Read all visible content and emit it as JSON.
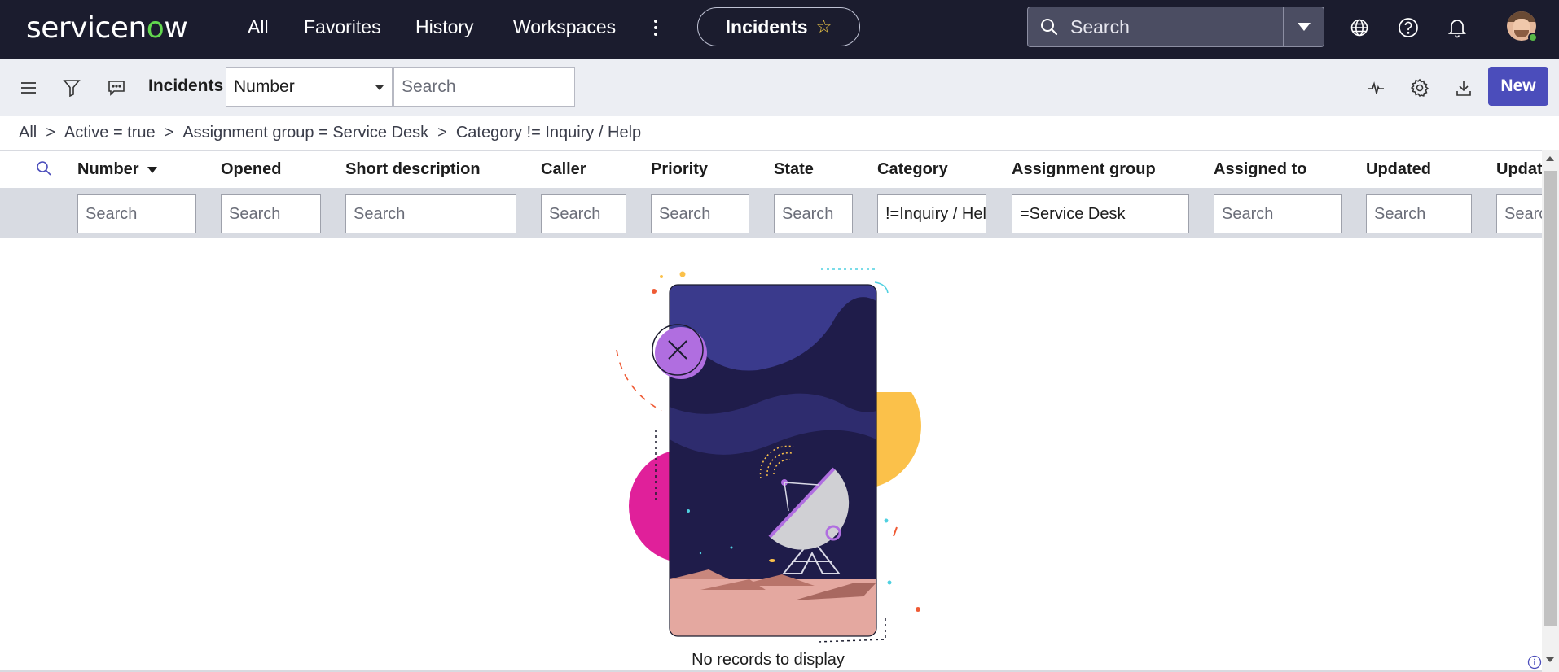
{
  "header": {
    "logo_text_1": "servicen",
    "logo_text_2": "o",
    "logo_text_3": "w",
    "nav": [
      "All",
      "Favorites",
      "History",
      "Workspaces"
    ],
    "context_title": "Incidents",
    "search_placeholder": "Search",
    "icons": [
      "globe-icon",
      "help-icon",
      "bell-icon"
    ]
  },
  "listbar": {
    "title": "Incidents",
    "field_select_value": "Number",
    "search_placeholder": "Search",
    "new_label": "New",
    "icons": [
      "hamburger-icon",
      "filter-icon",
      "comments-icon",
      "activity-icon",
      "gear-icon",
      "download-icon"
    ]
  },
  "breadcrumb": [
    "All",
    "Active = true",
    "Assignment group = Service Desk",
    "Category != Inquiry / Help"
  ],
  "table": {
    "columns": [
      "Number",
      "Opened",
      "Short description",
      "Caller",
      "Priority",
      "State",
      "Category",
      "Assignment group",
      "Assigned to",
      "Updated",
      "Updated by"
    ],
    "filters": [
      "Search",
      "Search",
      "Search",
      "Search",
      "Search",
      "Search",
      "!=Inquiry / Help",
      "=Service Desk",
      "Search",
      "Search",
      "Search"
    ]
  },
  "empty_state": {
    "message": "No records to display"
  },
  "colors": {
    "banner": "#1b1c2e",
    "accent": "#4b4dbb",
    "logo_o": "#62d84e"
  }
}
